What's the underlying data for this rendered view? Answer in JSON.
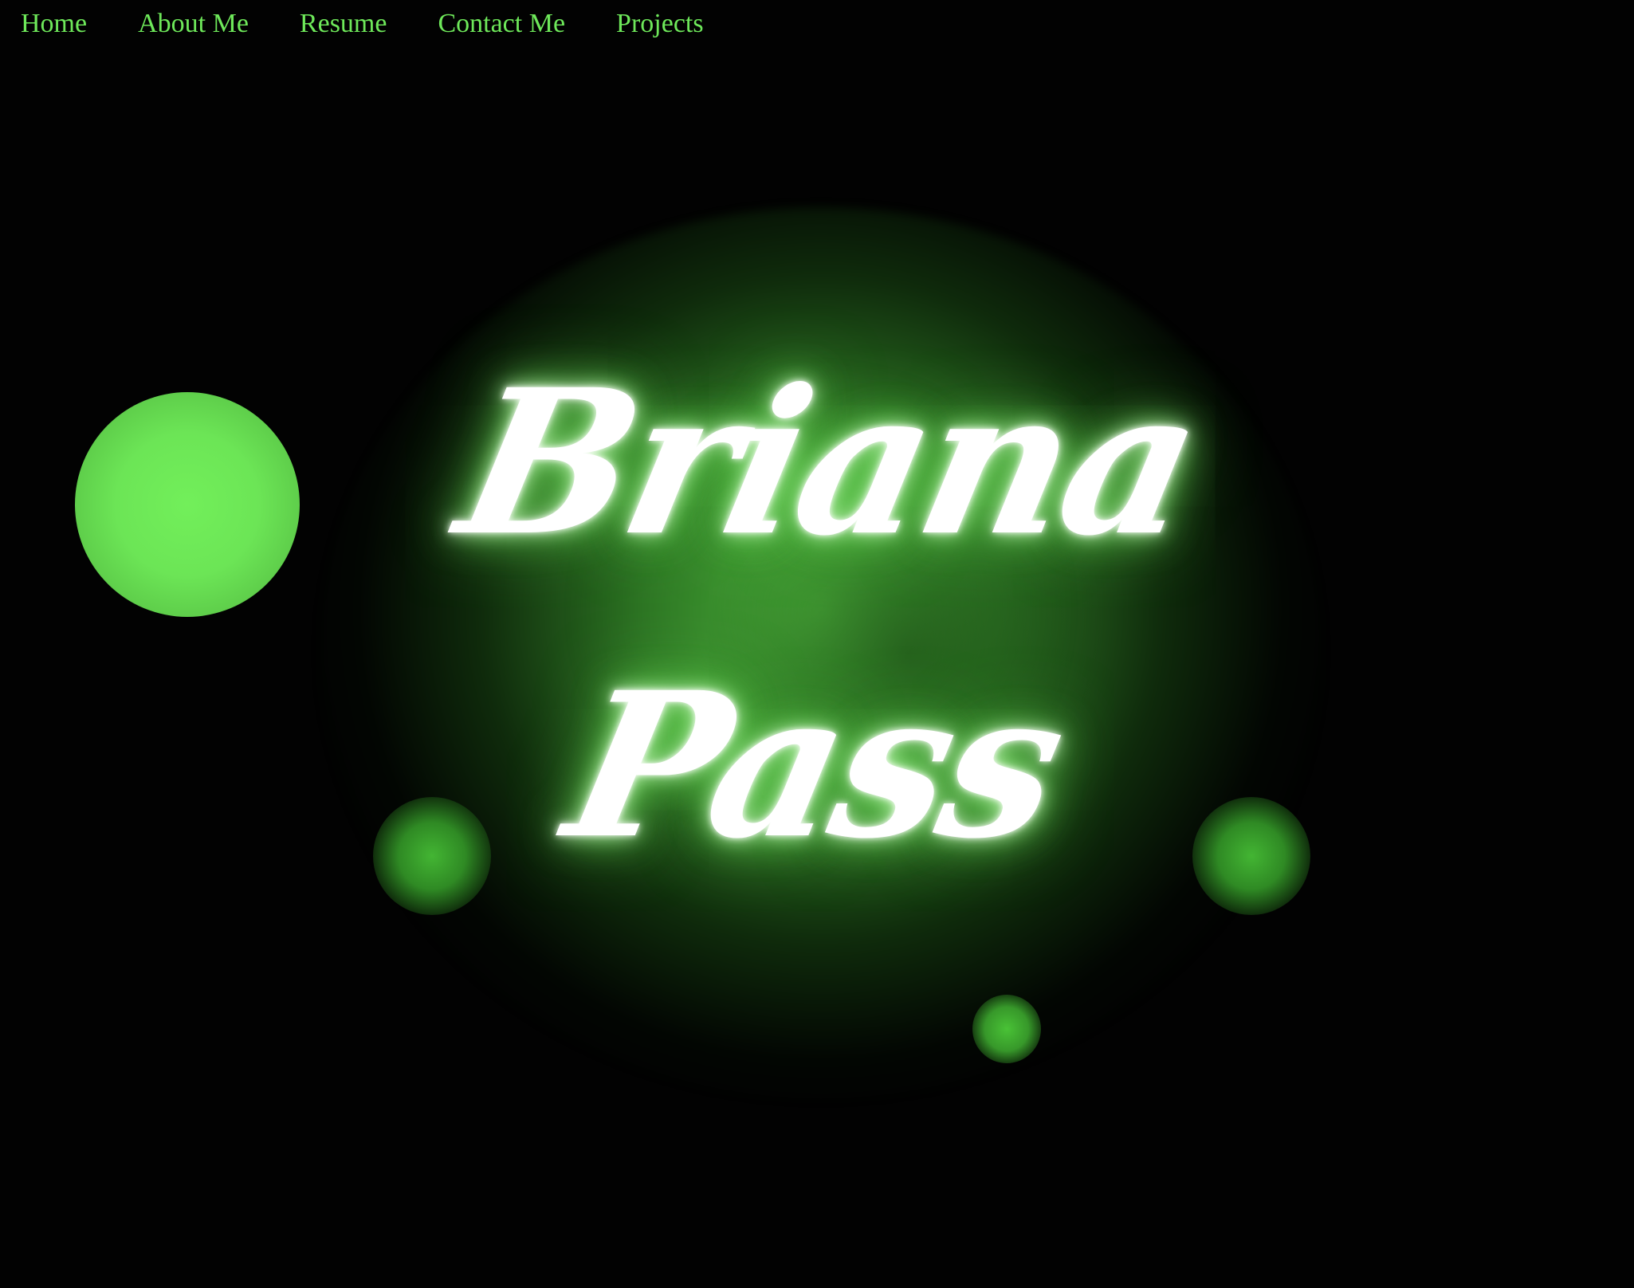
{
  "nav": {
    "items": [
      {
        "label": "Home"
      },
      {
        "label": "About Me"
      },
      {
        "label": "Resume"
      },
      {
        "label": "Contact Me"
      },
      {
        "label": "Projects"
      }
    ]
  },
  "hero": {
    "first_name": "Briana",
    "last_name": "Pass"
  },
  "colors": {
    "background": "#000000",
    "nav_link": "#6ee85a",
    "glow": "#5fd14a",
    "name_text": "#ffffff"
  }
}
